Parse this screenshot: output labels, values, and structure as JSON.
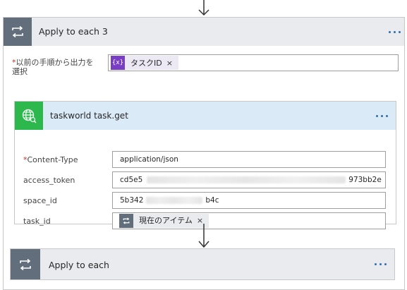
{
  "outer_scope": {
    "title": "Apply to each 3",
    "more_label": "...",
    "select_label_required": "*",
    "select_label": "以前の手順から出力を選択",
    "token": {
      "label": "タスクID",
      "icon_glyph": "{x}",
      "remove": "×",
      "icon_color": "#7a3ec5"
    }
  },
  "action": {
    "title": "taskworld task.get",
    "connector_color": "#2db84d",
    "fields": [
      {
        "label": "Content-Type",
        "required": "*",
        "value": "application/json"
      },
      {
        "label": "access_token",
        "value_start": "cd5e5",
        "value_end": "973bb2e"
      },
      {
        "label": "space_id",
        "value_start": "5b342",
        "value_end": "b4c"
      },
      {
        "label": "task_id",
        "token_label": "現在のアイテム",
        "token_remove": "×"
      }
    ]
  },
  "next_scope": {
    "title": "Apply to each"
  },
  "colors": {
    "loop_icon": "#626e7c",
    "scope_header": "#e9ebee",
    "action_header": "#dbeaf7",
    "dots": "#2d6fb3"
  },
  "icons": [
    "arrow-down-icon",
    "loop-icon",
    "variable-icon",
    "globe-icon",
    "more-icon"
  ]
}
